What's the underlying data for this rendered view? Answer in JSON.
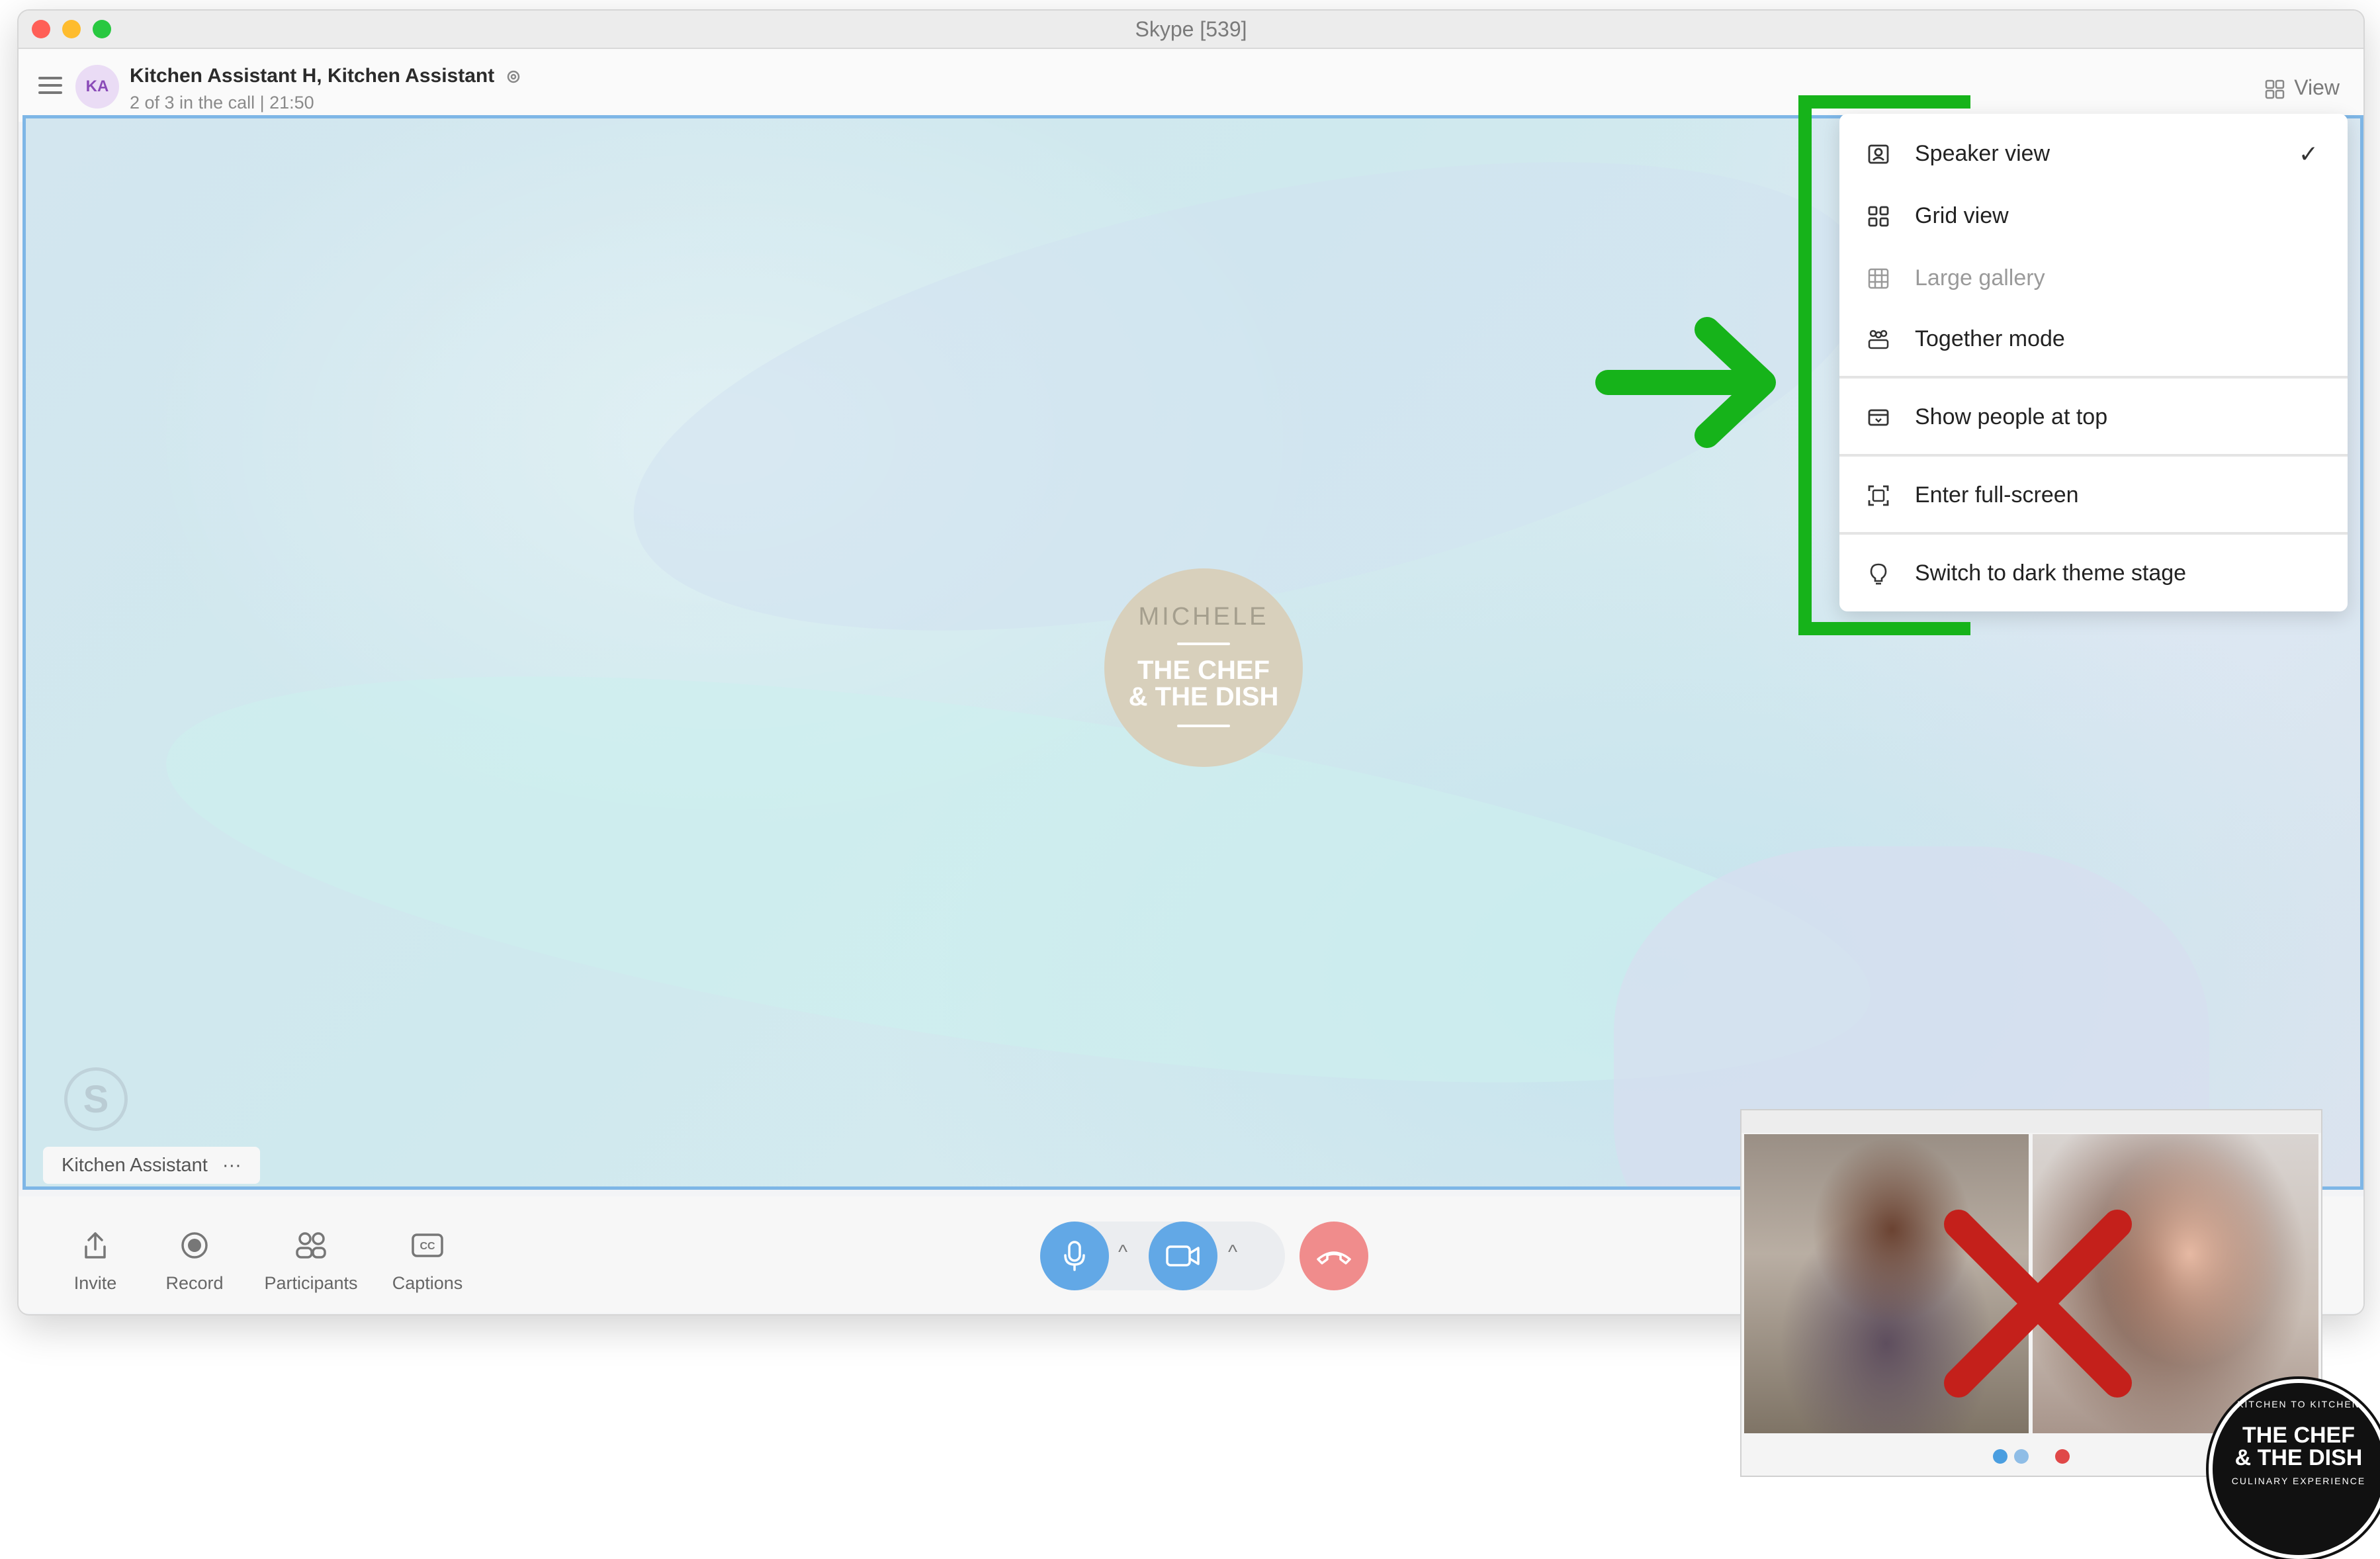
{
  "window": {
    "title": "Skype [539]"
  },
  "header": {
    "avatar_initials": "KA",
    "call_title": "Kitchen Assistant H, Kitchen Assistant",
    "call_subtitle": "2 of 3 in the call | 21:50",
    "view_label": "View"
  },
  "stage": {
    "participant_name": "Kitchen Assistant",
    "participant_more": "···",
    "logo_top": "MICHELE",
    "logo_line1": "THE CHEF",
    "logo_line2": "& THE DISH"
  },
  "view_menu": {
    "items": [
      {
        "label": "Speaker view",
        "icon": "speaker-view-icon",
        "checked": true,
        "disabled": false
      },
      {
        "label": "Grid view",
        "icon": "grid-view-icon",
        "checked": false,
        "disabled": false
      },
      {
        "label": "Large gallery",
        "icon": "large-gallery-icon",
        "checked": false,
        "disabled": true
      },
      {
        "label": "Together mode",
        "icon": "together-mode-icon",
        "checked": false,
        "disabled": false
      },
      {
        "label": "Show people at top",
        "icon": "people-at-top-icon",
        "checked": false,
        "disabled": false
      },
      {
        "label": "Enter full-screen",
        "icon": "fullscreen-icon",
        "checked": false,
        "disabled": false
      },
      {
        "label": "Switch to dark theme stage",
        "icon": "lightbulb-icon",
        "checked": false,
        "disabled": false
      }
    ],
    "check_mark": "✓"
  },
  "toolbar": {
    "invite": "Invite",
    "record": "Record",
    "participants": "Participants",
    "captions": "Captions"
  },
  "badge": {
    "top_text": "KITCHEN TO KITCHEN",
    "line1": "THE CHEF",
    "line2": "& THE DISH",
    "bottom_text": "CULINARY EXPERIENCE"
  },
  "colors": {
    "accent_blue": "#4a9ee0",
    "hangup_red": "#f08c8c",
    "annotation_green": "#16b31a",
    "annotation_red": "#c4201b",
    "avatar_bg": "#eadcf5",
    "avatar_fg": "#8a4bb8"
  }
}
